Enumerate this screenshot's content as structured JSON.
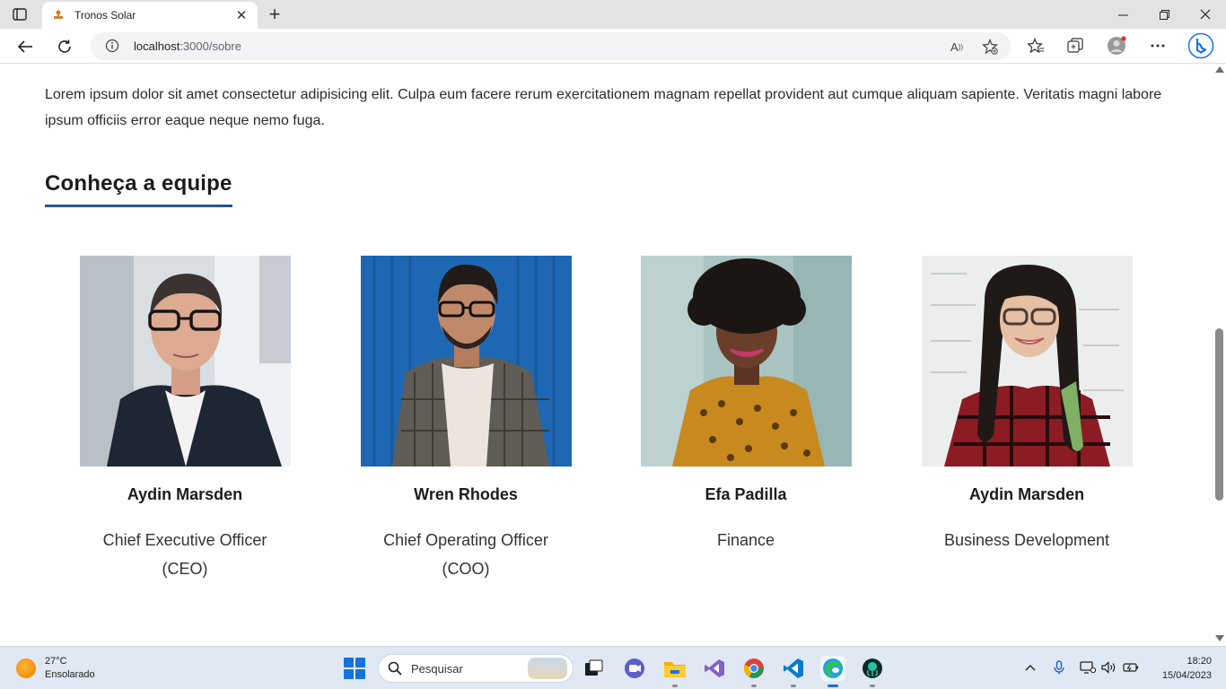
{
  "browser": {
    "tab_title": "Tronos Solar",
    "tab_close": "✕",
    "new_tab": "+",
    "url_host": "localhost",
    "url_path": ":3000/sobre",
    "read_aloud_label": "A"
  },
  "page": {
    "intro": "Lorem ipsum dolor sit amet consectetur adipisicing elit. Culpa eum facere rerum exercitationem magnam repellat provident aut cumque aliquam sapiente. Veritatis magni labore ipsum officiis error eaque neque nemo fuga.",
    "section_title": "Conheça a equipe",
    "team": [
      {
        "name": "Aydin Marsden",
        "role": "Chief Executive Officer (CEO)"
      },
      {
        "name": "Wren Rhodes",
        "role": "Chief Operating Officer (COO)"
      },
      {
        "name": "Efa Padilla",
        "role": "Finance"
      },
      {
        "name": "Aydin Marsden",
        "role": "Business Development"
      }
    ]
  },
  "taskbar": {
    "weather_temp": "27°C",
    "weather_desc": "Ensolarado",
    "search_placeholder": "Pesquisar",
    "time": "18:20",
    "date": "15/04/2023"
  },
  "colors": {
    "accent_underline": "#1e5a8c",
    "windows_blue": "#1673d9"
  }
}
